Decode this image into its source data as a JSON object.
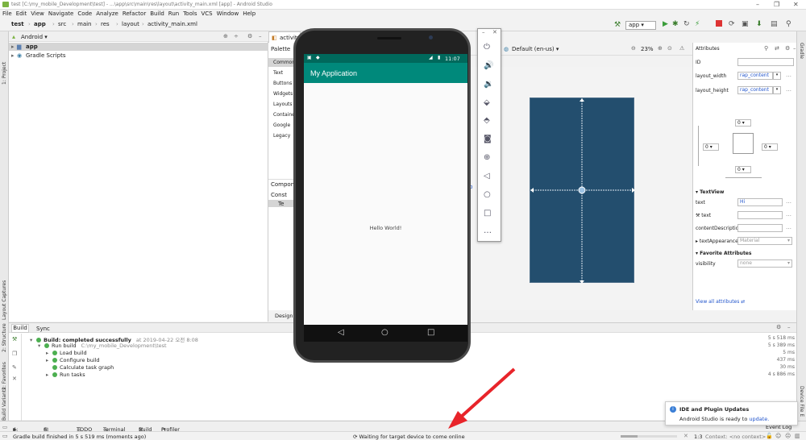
{
  "window": {
    "title": "test [C:\\my_mobile_Development\\test] - ...\\app\\src\\main\\res\\layout\\activity_main.xml [app] - Android Studio"
  },
  "menu": [
    "File",
    "Edit",
    "View",
    "Navigate",
    "Code",
    "Analyze",
    "Refactor",
    "Build",
    "Run",
    "Tools",
    "VCS",
    "Window",
    "Help"
  ],
  "breadcrumbs": [
    "test",
    "app",
    "src",
    "main",
    "res",
    "layout",
    "activity_main.xml"
  ],
  "toolbar": {
    "run_config": "app"
  },
  "left_strip": {
    "project": "1: Project",
    "layout_captures": "Layout Captures",
    "structure": "2: Structure",
    "favorites": "2: Favorites",
    "build_variants": "Build Variants"
  },
  "right_strip": {
    "gradle": "Gradle",
    "device_file": "Device File E"
  },
  "project_panel": {
    "view_mode": "Android",
    "items": [
      {
        "label": "app"
      },
      {
        "label": "Gradle Scripts"
      }
    ]
  },
  "editor_tab": "activity",
  "palette": {
    "title": "Palette",
    "categories": [
      "Common",
      "Text",
      "Buttons",
      "Widgets",
      "Layouts",
      "Containe",
      "Google",
      "Legacy"
    ],
    "component_tree_title": "Compon",
    "tree_items": [
      "Const",
      "Te"
    ],
    "design_tab": "Design"
  },
  "design_toolbar": {
    "locale": "Default (en-us)",
    "zoom": "23%"
  },
  "attributes": {
    "title": "Attributes",
    "id_label": "ID",
    "layout_width_label": "layout_width",
    "layout_width_value": "rap_content",
    "layout_height_label": "layout_height",
    "layout_height_value": "rap_content",
    "margins": [
      "0",
      "0",
      "0",
      "0"
    ],
    "textview_section": "TextView",
    "text_label": "text",
    "text_value": "Hi",
    "tools_text_label": "text",
    "content_desc_label": "contentDescriptio",
    "text_appearance_label": "textAppearance",
    "text_appearance_value": "Material",
    "favorite_section": "Favorite Attributes",
    "visibility_label": "visibility",
    "visibility_value": "none",
    "view_all": "View all attributes"
  },
  "build": {
    "tabs": [
      "Build",
      "Sync"
    ],
    "rows": [
      {
        "label": "Build: completed successfully",
        "extra": "at 2019-04-22 오전 8:08",
        "time": "5 s 518 ms"
      },
      {
        "label": "Run build",
        "extra": "C:\\my_mobile_Development\\test",
        "time": "5 s 389 ms"
      },
      {
        "label": "Load build",
        "extra": "",
        "time": "5 ms"
      },
      {
        "label": "Configure build",
        "extra": "",
        "time": "437 ms"
      },
      {
        "label": "Calculate task graph",
        "extra": "",
        "time": "30 ms"
      },
      {
        "label": "Run tasks",
        "extra": "",
        "time": "4 s 886 ms"
      }
    ]
  },
  "bottom_tabs": [
    "4: Run",
    "6: Logcat",
    "TODO",
    "Terminal",
    "Build",
    "Profiler"
  ],
  "event_log": "Event Log",
  "status": {
    "left": "Gradle build finished in 5 s 519 ms (moments ago)",
    "center": "Waiting for target device to come online",
    "position": "1:3",
    "context": "Context: <no context>"
  },
  "notification": {
    "title": "IDE and Plugin Updates",
    "body": "Android Studio is ready to",
    "link": "update."
  },
  "phone": {
    "time": "11:07",
    "app_title": "My Application",
    "content": "Hello World!"
  },
  "colors": {
    "accent": "#00897b",
    "arrow": "#e8242a",
    "blueprint": "#234e6e"
  }
}
